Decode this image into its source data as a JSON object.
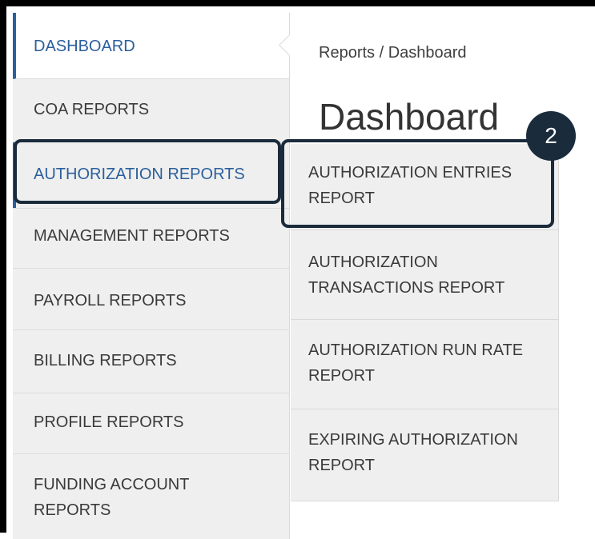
{
  "sidebar": {
    "items": [
      {
        "label": "DASHBOARD"
      },
      {
        "label": "COA REPORTS"
      },
      {
        "label": "AUTHORIZATION REPORTS"
      },
      {
        "label": "MANAGEMENT REPORTS"
      },
      {
        "label": "PAYROLL REPORTS"
      },
      {
        "label": "BILLING REPORTS"
      },
      {
        "label": "PROFILE REPORTS"
      },
      {
        "label": "FUNDING ACCOUNT REPORTS"
      }
    ]
  },
  "main": {
    "breadcrumb": "Reports / Dashboard",
    "title": "Dashboard"
  },
  "submenu": {
    "items": [
      {
        "label": "AUTHORIZATION ENTRIES REPORT"
      },
      {
        "label": "AUTHORIZATION TRANSACTIONS REPORT"
      },
      {
        "label": "AUTHORIZATION RUN RATE REPORT"
      },
      {
        "label": "EXPIRING AUTHORIZATION REPORT"
      }
    ]
  },
  "annotation": {
    "step_number": "2"
  },
  "colors": {
    "accent": "#2b5f9c",
    "highlight": "#1a2b3c",
    "menu_bg": "#efefef"
  }
}
